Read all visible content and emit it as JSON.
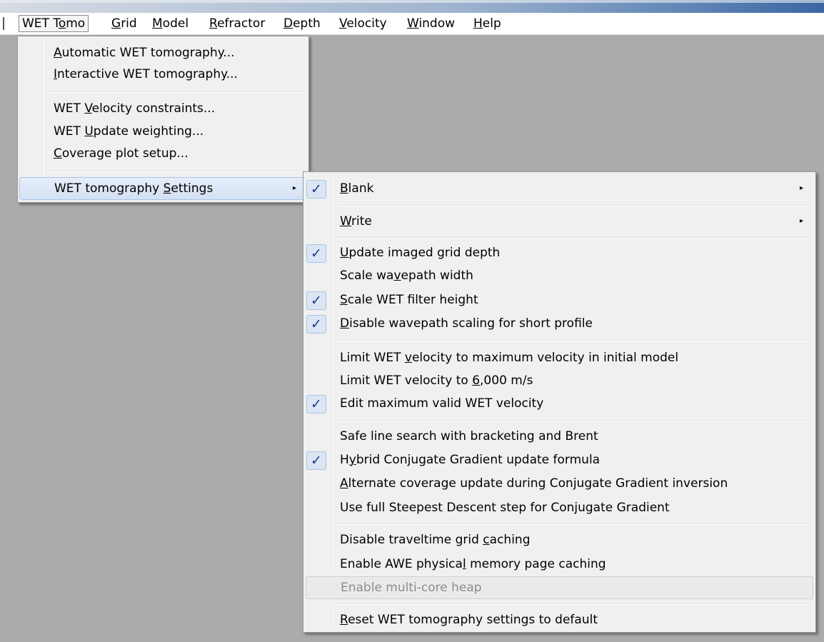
{
  "menubar": {
    "items": [
      {
        "pre": "WET T",
        "acc": "o",
        "post": "mo"
      },
      {
        "pre": "",
        "acc": "G",
        "post": "rid"
      },
      {
        "pre": "",
        "acc": "M",
        "post": "odel"
      },
      {
        "pre": "",
        "acc": "R",
        "post": "efractor"
      },
      {
        "pre": "",
        "acc": "D",
        "post": "epth"
      },
      {
        "pre": "",
        "acc": "V",
        "post": "elocity"
      },
      {
        "pre": "",
        "acc": "W",
        "post": "indow"
      },
      {
        "pre": "",
        "acc": "H",
        "post": "elp"
      }
    ]
  },
  "wet_menu": {
    "items": [
      {
        "pre": "",
        "acc": "A",
        "post": "utomatic WET tomography..."
      },
      {
        "pre": "",
        "acc": "I",
        "post": "nteractive WET tomography..."
      },
      {
        "pre": "WET ",
        "acc": "V",
        "post": "elocity constraints..."
      },
      {
        "pre": "WET ",
        "acc": "U",
        "post": "pdate weighting..."
      },
      {
        "pre": "",
        "acc": "C",
        "post": "overage plot setup..."
      },
      {
        "pre": "WET tomography ",
        "acc": "S",
        "post": "ettings"
      }
    ],
    "submenu_arrow": "▸"
  },
  "settings_menu": {
    "check_glyph": "✓",
    "arrow_glyph": "▸",
    "items": [
      {
        "pre": "",
        "acc": "B",
        "post": "lank",
        "checked": true
      },
      {
        "pre": "",
        "acc": "W",
        "post": "rite",
        "checked": false
      },
      {
        "pre": "",
        "acc": "U",
        "post": "pdate imaged grid depth",
        "checked": true
      },
      {
        "pre": "Scale wa",
        "acc": "v",
        "post": "epath width",
        "checked": false
      },
      {
        "pre": "",
        "acc": "S",
        "post": "cale WET filter height",
        "checked": true
      },
      {
        "pre": "",
        "acc": "D",
        "post": "isable wavepath scaling for short profile",
        "checked": true
      },
      {
        "pre": "Limit WET ",
        "acc": "v",
        "post": "elocity to maximum velocity in initial model",
        "checked": false
      },
      {
        "pre": "Limit WET velocity to ",
        "acc": "6",
        "post": ",000 m/s",
        "checked": false
      },
      {
        "pre": "Edit maximum valid WET velocity",
        "acc": "",
        "post": "",
        "checked": true
      },
      {
        "pre": "Safe line search with bracketing and Brent",
        "acc": "",
        "post": "",
        "checked": false
      },
      {
        "pre": "H",
        "acc": "y",
        "post": "brid Conjugate Gradient update formula",
        "checked": true
      },
      {
        "pre": "",
        "acc": "A",
        "post": "lternate coverage update during Conjugate Gradient inversion",
        "checked": false
      },
      {
        "pre": "Use full Steepest Descent step for Conjugate Gradient",
        "acc": "",
        "post": "",
        "checked": false
      },
      {
        "pre": "Disable traveltime grid ",
        "acc": "c",
        "post": "aching",
        "checked": false
      },
      {
        "pre": "Enable AWE physica",
        "acc": "l",
        "post": " memory page caching",
        "checked": false
      },
      {
        "pre": "Enable multi-core heap",
        "acc": "",
        "post": "",
        "checked": false,
        "disabled": true
      },
      {
        "pre": "",
        "acc": "R",
        "post": "eset WET tomography settings to default",
        "checked": false
      }
    ]
  }
}
